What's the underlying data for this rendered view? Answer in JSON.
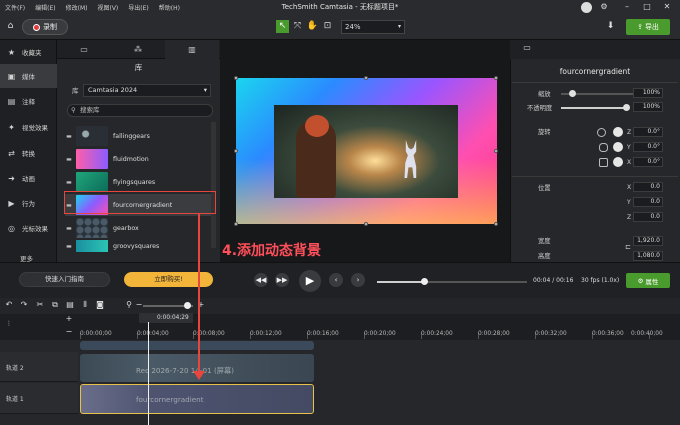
{
  "menu": [
    "文件(F)",
    "编辑(E)",
    "修改(M)",
    "视图(V)",
    "导出(E)",
    "帮助(H)"
  ],
  "window_title": "TechSmith Camtasia - 无标题项目*",
  "toolbar": {
    "record_label": "录制",
    "zoom": "24%",
    "export_label": "导出"
  },
  "sidebar": {
    "items": [
      {
        "label": "收藏夹",
        "icon": "star-icon"
      },
      {
        "label": "媒体",
        "icon": "media-icon"
      },
      {
        "label": "注释",
        "icon": "annotation-icon"
      },
      {
        "label": "视觉效果",
        "icon": "visual-effects-icon"
      },
      {
        "label": "转换",
        "icon": "transition-icon"
      },
      {
        "label": "动画",
        "icon": "animation-icon"
      },
      {
        "label": "行为",
        "icon": "behavior-icon"
      },
      {
        "label": "光标效果",
        "icon": "cursor-effects-icon"
      }
    ],
    "more_label": "更多"
  },
  "library": {
    "heading": "库",
    "library_label": "库",
    "selected_library": "Camtasia 2024",
    "search_placeholder": "搜索库",
    "items": [
      {
        "name": "fallinggears"
      },
      {
        "name": "fluidmotion"
      },
      {
        "name": "flyingsquares"
      },
      {
        "name": "fourcornergradient"
      },
      {
        "name": "gearbox"
      },
      {
        "name": "groovysquares"
      }
    ]
  },
  "properties": {
    "title": "fourcornergradient",
    "scale_label": "缩放",
    "scale_value": "100%",
    "opacity_label": "不透明度",
    "opacity_value": "100%",
    "rotation_label": "旋转",
    "rotation": [
      {
        "axis": "Z",
        "value": "0.0°"
      },
      {
        "axis": "Y",
        "value": "0.0°"
      },
      {
        "axis": "X",
        "value": "0.0°"
      }
    ],
    "position_label": "位置",
    "position": [
      {
        "axis": "X",
        "value": "0.0"
      },
      {
        "axis": "Y",
        "value": "0.0"
      },
      {
        "axis": "Z",
        "value": "0.0"
      }
    ],
    "width_label": "宽度",
    "width_value": "1,920.0",
    "height_label": "高度",
    "height_value": "1,080.0"
  },
  "controls": {
    "quick_guide_label": "快速入门指南",
    "buy_label": "立即购买!",
    "timecode": "00:04 / 00:16",
    "fps": "30 fps (1.0x)",
    "properties_label": "属性"
  },
  "timeline": {
    "playhead_time": "0:00:04;29",
    "ticks": [
      "0:00:00;00",
      "0:00:04;00",
      "0:00:08;00",
      "0:00:12;00",
      "0:00:16;00",
      "0:00:20;00",
      "0:00:24;00",
      "0:00:28;00",
      "0:00:32;00",
      "0:00:36;00",
      "0:00:40;00"
    ],
    "tracks": [
      {
        "name": "轨道 2",
        "clip_label": "Rec 2026-7-20 14-01 (屏幕)"
      },
      {
        "name": "轨道 1",
        "clip_label": "fourcornergradient"
      }
    ]
  },
  "annotation": "4.添加动态背景"
}
